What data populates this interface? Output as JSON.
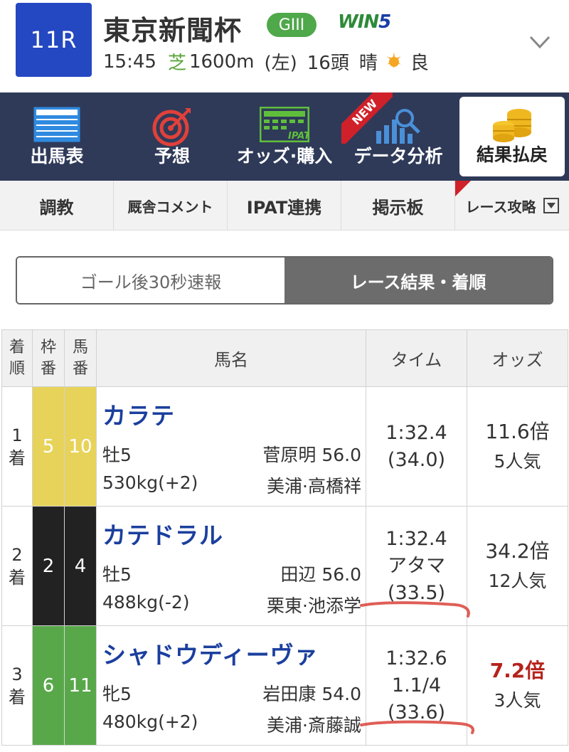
{
  "race": {
    "number": "11R",
    "title": "東京新聞杯",
    "grade": "GIII",
    "win5_logo": "WIN",
    "win5_num": "5",
    "time": "15:45",
    "surface": "芝",
    "distance": "1600m",
    "direction": "(左)",
    "runners": "16頭",
    "weather": "晴",
    "going": "良"
  },
  "nav": {
    "items": [
      {
        "label": "出馬表",
        "icon": "entry-table-icon"
      },
      {
        "label": "予想",
        "icon": "target-icon"
      },
      {
        "label": "オッズ·購入",
        "icon": "ipat-icon"
      },
      {
        "label": "データ分析",
        "icon": "chart-search-icon",
        "badge": "NEW"
      },
      {
        "label": "結果払戻",
        "icon": "coins-icon",
        "active": true
      }
    ]
  },
  "subnav": {
    "items": [
      {
        "label": "調教"
      },
      {
        "label": "厩舎コメント"
      },
      {
        "label": "IPAT連携"
      },
      {
        "label": "掲示板"
      },
      {
        "label": "レース攻略"
      }
    ]
  },
  "segment": {
    "left": "ゴール後30秒速報",
    "right": "レース結果・着順",
    "selected": "right"
  },
  "table": {
    "headers": {
      "rank_1": "着",
      "rank_2": "順",
      "frame_1": "枠",
      "frame_2": "番",
      "horse_no_1": "馬",
      "horse_no_2": "番",
      "name": "馬名",
      "time": "タイム",
      "odds": "オッズ"
    },
    "rows": [
      {
        "rank_num": "1",
        "rank_suffix": "着",
        "frame": "5",
        "frame_color": "#e8d35a",
        "horse_no": "10",
        "name": "カラテ",
        "sex_age": "牡5",
        "jockey_weight": "菅原明 56.0",
        "body_weight": "530kg(+2)",
        "trainer": "美浦·高橋祥",
        "time": "1:32.4",
        "margin": "",
        "last3f": "(34.0)",
        "odds": "11.6倍",
        "popularity": "5人気"
      },
      {
        "rank_num": "2",
        "rank_suffix": "着",
        "frame": "2",
        "frame_color": "#222222",
        "horse_no": "4",
        "name": "カテドラル",
        "sex_age": "牡5",
        "jockey_weight": "田辺 56.0",
        "body_weight": "488kg(-2)",
        "trainer": "栗東·池添学",
        "time": "1:32.4",
        "margin": "アタマ",
        "last3f": "(33.5)",
        "odds": "34.2倍",
        "popularity": "12人気"
      },
      {
        "rank_num": "3",
        "rank_suffix": "着",
        "frame": "6",
        "frame_color": "#58a84a",
        "horse_no": "11",
        "name": "シャドウディーヴァ",
        "sex_age": "牝5",
        "jockey_weight": "岩田康 54.0",
        "body_weight": "480kg(+2)",
        "trainer": "美浦·斎藤誠",
        "time": "1:32.6",
        "margin": "1.1/4",
        "last3f": "(33.6)",
        "odds": "7.2倍",
        "popularity": "3人気"
      }
    ]
  },
  "colors": {
    "race_badge": "#2447c2",
    "nav_bg": "#2f3a59",
    "horse_name": "#1b3f9e",
    "hot_odds": "#b5231c",
    "annotation": "#d9423a"
  }
}
